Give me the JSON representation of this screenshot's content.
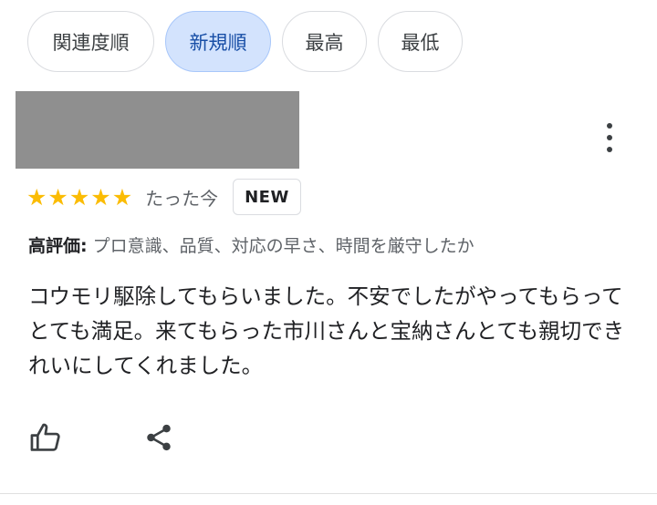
{
  "sort_chips": [
    {
      "label": "関連度順",
      "selected": false
    },
    {
      "label": "新規順",
      "selected": true
    },
    {
      "label": "最高",
      "selected": false
    },
    {
      "label": "最低",
      "selected": false
    }
  ],
  "review": {
    "star_rating": 5,
    "max_stars": 5,
    "time": "たった今",
    "badge": "NEW",
    "highlights_label": "高評価:",
    "highlights_text": " プロ意識、品質、対応の早さ、時間を厳守したか",
    "body": "コウモリ駆除してもらいました。不安でしたがやってもらってとても満足。来てもらった市川さんと宝納さんとても親切できれいにしてくれました。"
  },
  "icons": {
    "more": "more-vert-icon",
    "like": "thumb-up-icon",
    "share": "share-icon",
    "star": "star-icon"
  },
  "colors": {
    "star": "#fbbc04",
    "chip_selected_bg": "#d3e3fd",
    "chip_selected_text": "#174ea6",
    "redaction": "#8f8f8f"
  }
}
